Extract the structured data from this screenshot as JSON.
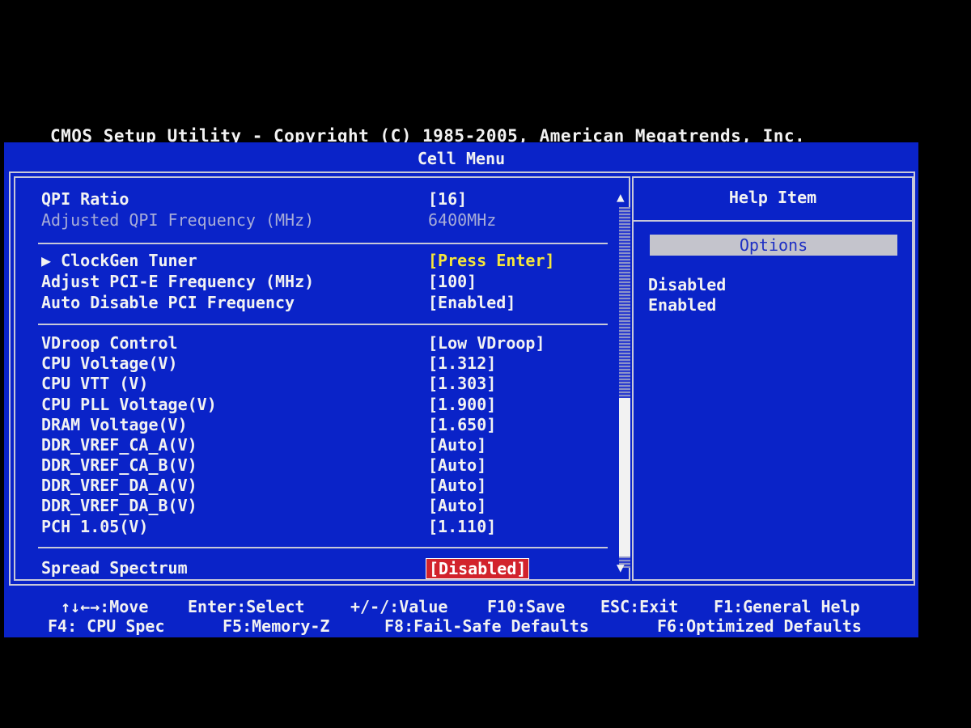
{
  "header": {
    "title": "CMOS Setup Utility - Copyright (C) 1985-2005, American Megatrends, Inc.",
    "subtitle": "Cell Menu"
  },
  "rows": [
    {
      "label": "QPI Ratio",
      "value": "[16]"
    },
    {
      "label": "Adjusted QPI Frequency (MHz)",
      "value": "6400MHz"
    },
    {
      "label": "▶ ClockGen Tuner",
      "value": "[Press Enter]"
    },
    {
      "label": "Adjust PCI-E Frequency (MHz)",
      "value": "[100]"
    },
    {
      "label": "Auto Disable PCI Frequency",
      "value": "[Enabled]"
    },
    {
      "label": "VDroop Control",
      "value": "[Low VDroop]"
    },
    {
      "label": "CPU Voltage(V)",
      "value": "[1.312]"
    },
    {
      "label": "CPU VTT (V)",
      "value": "[1.303]"
    },
    {
      "label": "CPU PLL Voltage(V)",
      "value": "[1.900]"
    },
    {
      "label": "DRAM Voltage(V)",
      "value": "[1.650]"
    },
    {
      "label": "DDR_VREF_CA_A(V)",
      "value": "[Auto]"
    },
    {
      "label": "DDR_VREF_CA_B(V)",
      "value": "[Auto]"
    },
    {
      "label": "DDR_VREF_DA_A(V)",
      "value": "[Auto]"
    },
    {
      "label": "DDR_VREF_DA_B(V)",
      "value": "[Auto]"
    },
    {
      "label": "PCH 1.05(V)",
      "value": "[1.110]"
    },
    {
      "label": "Spread Spectrum",
      "value": "[Disabled]"
    }
  ],
  "scrollbar": {
    "up_glyph": "▲",
    "down_glyph": "▼"
  },
  "help": {
    "title": "Help Item",
    "options_label": "Options",
    "options": [
      "Disabled",
      "Enabled"
    ]
  },
  "footer": {
    "line1": [
      "↑↓←→:Move",
      "Enter:Select",
      "+/-/:Value",
      "F10:Save",
      "ESC:Exit",
      "F1:General Help"
    ],
    "line2": [
      "F4: CPU Spec",
      "F5:Memory-Z",
      "F8:Fail-Safe Defaults",
      "F6:Optimized Defaults"
    ]
  },
  "colors": {
    "background": "#0a23c8",
    "text": "#f2f2f2",
    "dim_text": "#a7acd8",
    "highlight_yellow": "#f5e63a",
    "selected_bg": "#d2232c"
  }
}
